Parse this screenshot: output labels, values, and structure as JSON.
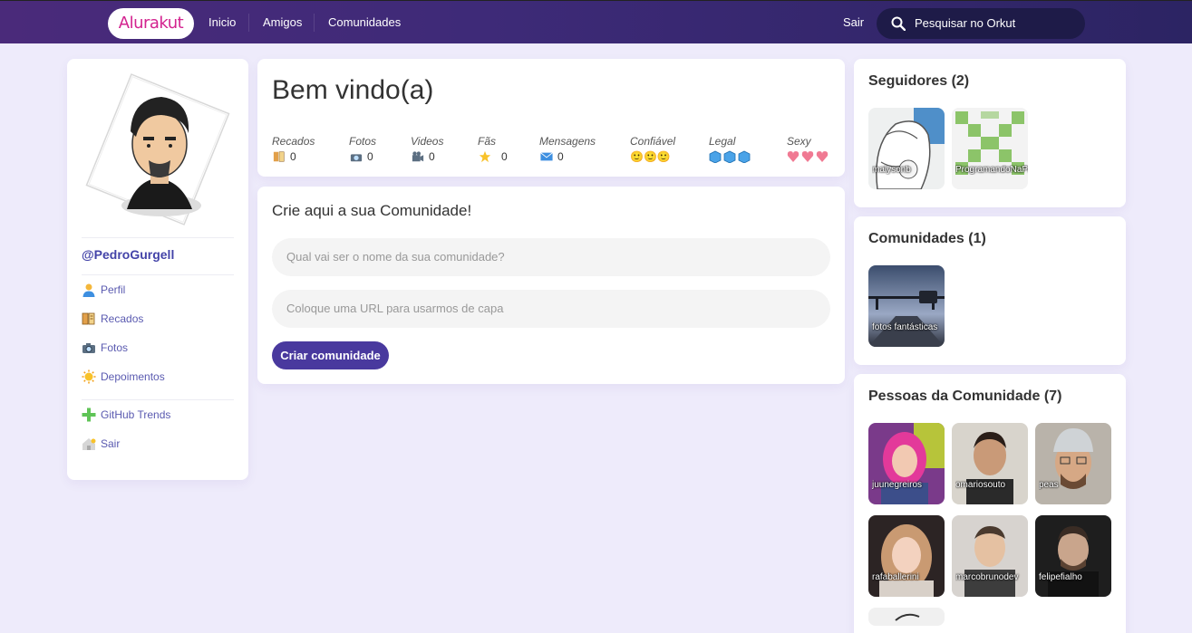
{
  "header": {
    "logo": "Alurakut",
    "nav": [
      "Inicio",
      "Amigos",
      "Comunidades"
    ],
    "logout": "Sair",
    "search_label": "Pesquisar no Orkut"
  },
  "profile": {
    "handle": "@PedroGurgell",
    "menu": [
      "Perfil",
      "Recados",
      "Fotos",
      "Depoimentos"
    ],
    "menu2": [
      "GitHub Trends",
      "Sair"
    ]
  },
  "welcome": {
    "title": "Bem vindo(a)",
    "stats": [
      {
        "label": "Recados",
        "value": "0"
      },
      {
        "label": "Fotos",
        "value": "0"
      },
      {
        "label": "Videos",
        "value": "0"
      },
      {
        "label": "Fãs",
        "value": "0"
      },
      {
        "label": "Mensagens",
        "value": "0"
      },
      {
        "label": "Confiável",
        "value": ""
      },
      {
        "label": "Legal",
        "value": ""
      },
      {
        "label": "Sexy",
        "value": ""
      }
    ]
  },
  "create": {
    "title": "Crie aqui a sua Comunidade!",
    "name_placeholder": "Qual vai ser o nome da sua comunidade?",
    "url_placeholder": "Coloque uma URL para usarmos de capa",
    "submit": "Criar comunidade"
  },
  "followers": {
    "title": "Seguidores (2)",
    "items": [
      "malysonb",
      "ProgramandoNaPratica"
    ]
  },
  "communities": {
    "title": "Comunidades (1)",
    "items": [
      "fotos fantásticas"
    ]
  },
  "people": {
    "title": "Pessoas da Comunidade (7)",
    "items": [
      "juunegreiros",
      "omariosouto",
      "peas",
      "rafaballerini",
      "marcobrunodev",
      "felipefialho"
    ]
  },
  "colors": {
    "accent": "#49399e",
    "logo": "#d3238f",
    "handle": "#4343a8",
    "background": "#eeebfb"
  }
}
